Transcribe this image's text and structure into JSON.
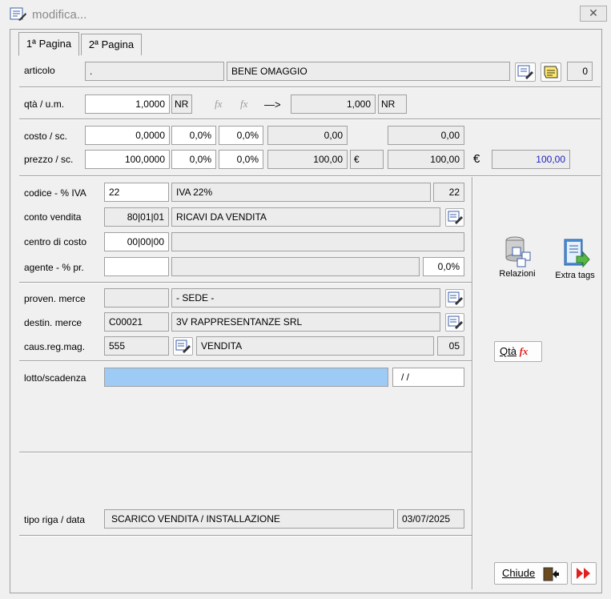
{
  "window": {
    "title": "modifica...",
    "close_label": "✕"
  },
  "tabs": [
    {
      "label": "1ª Pagina"
    },
    {
      "label": "2ª Pagina"
    }
  ],
  "articolo": {
    "label": "articolo",
    "code": ".",
    "description": "BENE OMAGGIO",
    "count": "0"
  },
  "qta": {
    "label": "qtà / u.m.",
    "value": "1,0000",
    "um": "NR",
    "fx1": "fx",
    "fx2": "fx",
    "arrow": "—>",
    "converted": "1,000",
    "um2": "NR"
  },
  "costo": {
    "label": "costo / sc.",
    "value": "0,0000",
    "sc1": "0,0%",
    "sc2": "0,0%",
    "net": "0,00",
    "total": "0,00"
  },
  "prezzo": {
    "label": "prezzo / sc.",
    "value": "100,0000",
    "sc1": "0,0%",
    "sc2": "0,0%",
    "net": "100,00",
    "currency": "€",
    "total": "100,00",
    "currency2": "€",
    "final": "100,00"
  },
  "codice_iva": {
    "label": "codice - % IVA",
    "code": "22",
    "description": "IVA 22%",
    "percent": "22"
  },
  "conto_vendita": {
    "label": "conto vendita",
    "code": "80|01|01",
    "description": "RICAVI DA VENDITA"
  },
  "centro_costo": {
    "label": "centro di costo",
    "code": "00|00|00",
    "description": ""
  },
  "agente": {
    "label": "agente - % pr.",
    "code": "",
    "description": "",
    "percent": "0,0%"
  },
  "proven_merce": {
    "label": "proven. merce",
    "code": "",
    "description": "- SEDE -"
  },
  "destin_merce": {
    "label": "destin. merce",
    "code": "C00021",
    "description": "3V RAPPRESENTANZE SRL"
  },
  "caus_reg_mag": {
    "label": "caus.reg.mag.",
    "code": "555",
    "description": "VENDITA",
    "num": "05"
  },
  "lotto": {
    "label": "lotto/scadenza",
    "value": "",
    "date": "/ /"
  },
  "tipo_riga": {
    "label": "tipo riga / data",
    "value": "SCARICO VENDITA / INSTALLAZIONE",
    "date": "03/07/2025"
  },
  "side": {
    "relazioni_label": "Relazioni",
    "extra_tags_label": "Extra tags",
    "qta_button_label": "Qtà",
    "qta_fx": "fx"
  },
  "footer": {
    "close_label": "Chiude"
  },
  "colors": {
    "highlight_field": "#9dcbf6",
    "yellow_bar": "#ffffe1",
    "accent_red": "#e0201c"
  }
}
